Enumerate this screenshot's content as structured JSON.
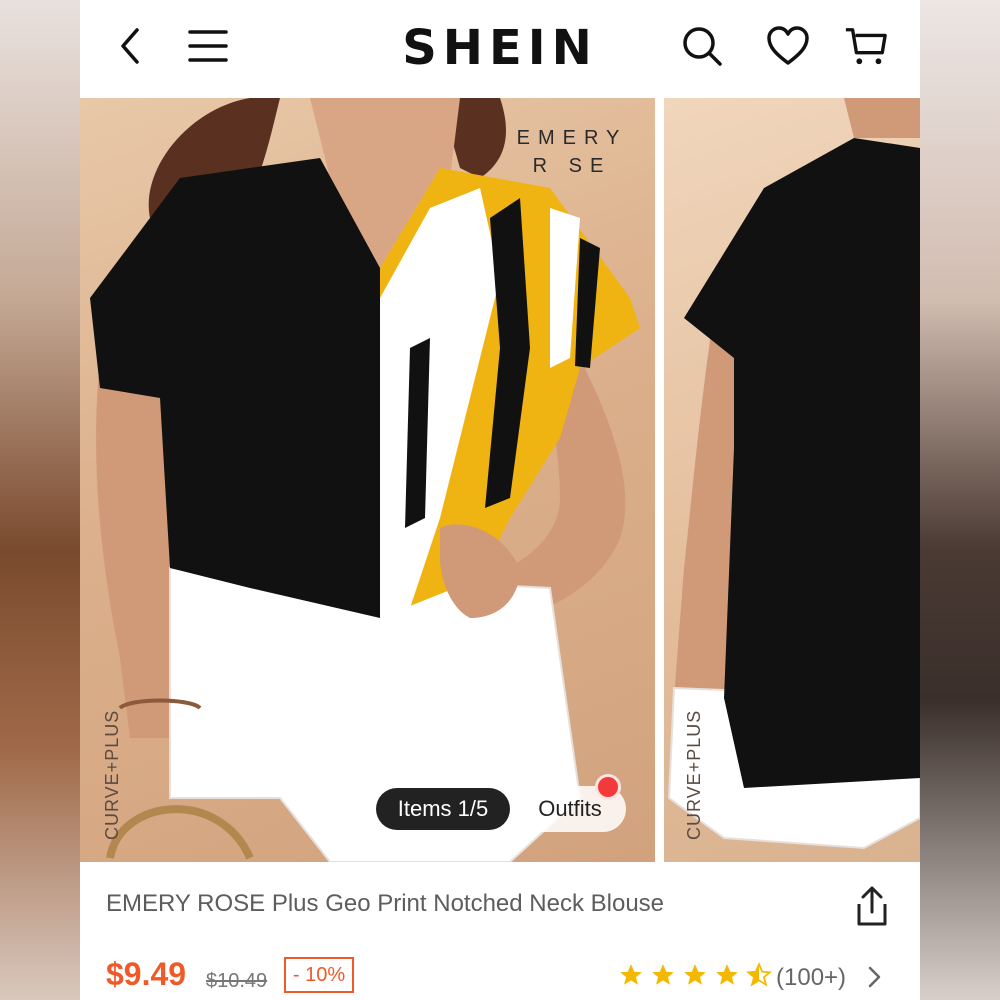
{
  "header": {
    "logo": "SHEIN",
    "back_icon": "chevron-left-icon",
    "menu_icon": "hamburger-menu-icon",
    "search_icon": "search-icon",
    "wishlist_icon": "heart-icon",
    "cart_icon": "cart-icon"
  },
  "gallery": {
    "brand_mark_line1": "EMERY",
    "brand_mark_line2": "R   SE",
    "side_label": "CURVE+PLUS",
    "items_pill": "Items 1/5",
    "outfits_pill": "Outfits"
  },
  "product": {
    "title": "EMERY ROSE Plus Geo Print Notched Neck Blouse",
    "price": "$9.49",
    "original_price": "$10.49",
    "discount": "- 10%",
    "rating_stars": 4.5,
    "review_count": "(100+)",
    "share_icon": "share-icon"
  },
  "colors": {
    "accent": "#f05a28",
    "star": "#f5b800"
  }
}
